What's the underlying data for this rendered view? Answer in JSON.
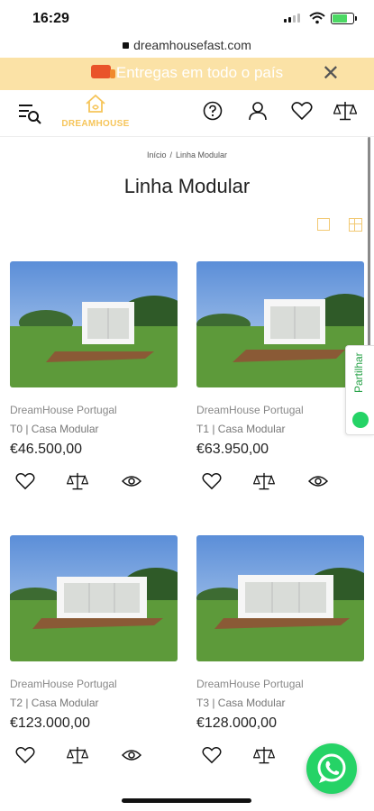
{
  "status": {
    "time": "16:29"
  },
  "browser": {
    "url": "dreamhousefast.com"
  },
  "promo": {
    "text": "Entregas em todo o país",
    "close_label": "✕"
  },
  "header": {
    "logo_text": "DREAMHOUSE"
  },
  "breadcrumb": {
    "home": "Início",
    "separator": "/",
    "current": "Linha Modular"
  },
  "page": {
    "title": "Linha Modular"
  },
  "share": {
    "label": "Partilhar"
  },
  "products": [
    {
      "brand": "DreamHouse Portugal",
      "name": "T0 | Casa Modular",
      "price": "€46.500,00"
    },
    {
      "brand": "DreamHouse Portugal",
      "name": "T1 | Casa Modular",
      "price": "€63.950,00"
    },
    {
      "brand": "DreamHouse Portugal",
      "name": "T2 | Casa Modular",
      "price": "€123.000,00"
    },
    {
      "brand": "DreamHouse Portugal",
      "name": "T3 | Casa Modular",
      "price": "€128.000,00"
    }
  ],
  "colors": {
    "accent": "#f6c55a",
    "promo_bg": "#fbe2a6",
    "whatsapp": "#25d366"
  },
  "icons": {
    "menu_search": "menu-search-icon",
    "help": "question-icon",
    "account": "user-icon",
    "wishlist": "heart-icon",
    "compare": "scale-icon",
    "quick_view": "eye-icon"
  }
}
